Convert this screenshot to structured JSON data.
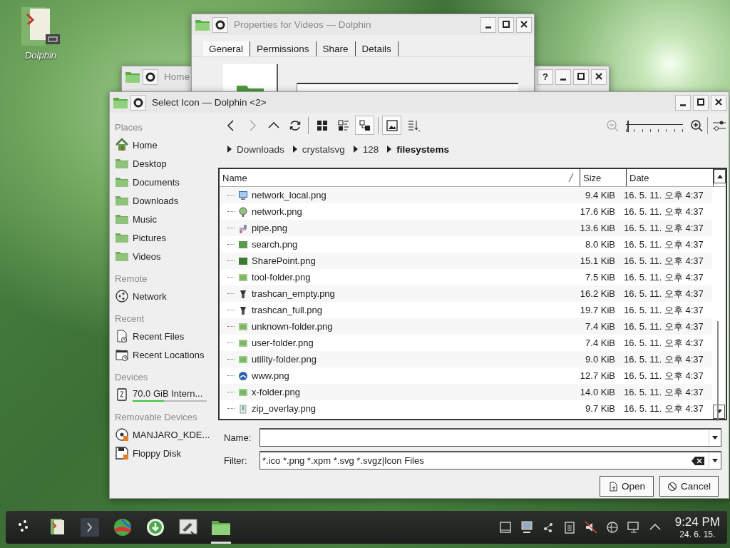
{
  "desktop": {
    "icons": [
      {
        "label": "Dolphin"
      }
    ]
  },
  "home_window": {
    "title": "Home",
    "help_button": "?"
  },
  "properties_window": {
    "title": "Properties for Videos — Dolphin",
    "tabs": [
      {
        "label": "General",
        "selected": true
      },
      {
        "label": "Permissions",
        "selected": false
      },
      {
        "label": "Share",
        "selected": false
      },
      {
        "label": "Details",
        "selected": false
      }
    ]
  },
  "dialog": {
    "title": "Select Icon — Dolphin <2>",
    "places": [
      {
        "heading": "Places",
        "items": [
          {
            "label": "Home",
            "kind": "home"
          },
          {
            "label": "Desktop",
            "kind": "folder"
          },
          {
            "label": "Documents",
            "kind": "folder"
          },
          {
            "label": "Downloads",
            "kind": "folder"
          },
          {
            "label": "Music",
            "kind": "folder"
          },
          {
            "label": "Pictures",
            "kind": "folder"
          },
          {
            "label": "Videos",
            "kind": "folder"
          }
        ]
      },
      {
        "heading": "Remote",
        "items": [
          {
            "label": "Network",
            "kind": "network"
          }
        ]
      },
      {
        "heading": "Recent",
        "items": [
          {
            "label": "Recent Files",
            "kind": "recent-file"
          },
          {
            "label": "Recent Locations",
            "kind": "recent-folder"
          }
        ]
      },
      {
        "heading": "Devices",
        "items": [
          {
            "label": "70.0 GiB Intern...",
            "kind": "drive",
            "level": 0.42
          }
        ]
      },
      {
        "heading": "Removable Devices",
        "items": [
          {
            "label": "MANJARO_KDE...",
            "kind": "disc"
          },
          {
            "label": "Floppy Disk",
            "kind": "floppy"
          }
        ]
      }
    ],
    "toolbar": [
      {
        "kind": "back",
        "disabled": false
      },
      {
        "kind": "forward",
        "disabled": true
      },
      {
        "kind": "up",
        "disabled": false
      },
      {
        "kind": "reload",
        "disabled": false
      },
      {
        "kind": "icons",
        "selected": false
      },
      {
        "kind": "compact",
        "selected": false
      },
      {
        "kind": "details",
        "selected": true
      },
      {
        "kind": "preview",
        "checked": true
      },
      {
        "kind": "sort"
      }
    ],
    "zoom": {
      "level": 0.03
    },
    "breadcrumb": [
      {
        "label": "Downloads",
        "current": false
      },
      {
        "label": "crystalsvg",
        "current": false
      },
      {
        "label": "128",
        "current": false
      },
      {
        "label": "filesystems",
        "current": true
      }
    ],
    "columns": [
      {
        "label": "Name"
      },
      {
        "label": "Size"
      },
      {
        "label": "Date"
      }
    ],
    "rows": [
      {
        "name": "network_local.png",
        "size": "9.4 KiB",
        "date": "16. 5. 11. 오후 4:37",
        "kind": "monitor"
      },
      {
        "name": "network.png",
        "size": "17.6 KiB",
        "date": "16. 5. 11. 오후 4:37",
        "kind": "globe"
      },
      {
        "name": "pipe.png",
        "size": "13.6 KiB",
        "date": "16. 5. 11. 오후 4:37",
        "kind": "pipe"
      },
      {
        "name": "search.png",
        "size": "8.0 KiB",
        "date": "16. 5. 11. 오후 4:37",
        "kind": "folder"
      },
      {
        "name": "SharePoint.png",
        "size": "15.1 KiB",
        "date": "16. 5. 11. 오후 4:37",
        "kind": "folder-dark"
      },
      {
        "name": "tool-folder.png",
        "size": "7.5 KiB",
        "date": "16. 5. 11. 오후 4:37",
        "kind": "folder-light"
      },
      {
        "name": "trashcan_empty.png",
        "size": "16.2 KiB",
        "date": "16. 5. 11. 오후 4:37",
        "kind": "trash"
      },
      {
        "name": "trashcan_full.png",
        "size": "19.7 KiB",
        "date": "16. 5. 11. 오후 4:37",
        "kind": "trash"
      },
      {
        "name": "unknown-folder.png",
        "size": "7.4 KiB",
        "date": "16. 5. 11. 오후 4:37",
        "kind": "folder-light"
      },
      {
        "name": "user-folder.png",
        "size": "7.4 KiB",
        "date": "16. 5. 11. 오후 4:37",
        "kind": "folder-light"
      },
      {
        "name": "utility-folder.png",
        "size": "9.0 KiB",
        "date": "16. 5. 11. 오후 4:37",
        "kind": "folder-light"
      },
      {
        "name": "www.png",
        "size": "12.7 KiB",
        "date": "16. 5. 11. 오후 4:37",
        "kind": "www"
      },
      {
        "name": "x-folder.png",
        "size": "14.0 KiB",
        "date": "16. 5. 11. 오후 4:37",
        "kind": "folder-light"
      },
      {
        "name": "zip_overlay.png",
        "size": "9.7 KiB",
        "date": "16. 5. 11. 오후 4:37",
        "kind": "zip"
      }
    ],
    "name_label": "Name:",
    "filter_label": "Filter:",
    "filter_value": "*.ico *.png *.xpm *.svg *.svgz|Icon Files",
    "buttons": [
      {
        "label": "Open",
        "kind": "open"
      },
      {
        "label": "Cancel",
        "kind": "cancel"
      }
    ]
  },
  "taskbar": {
    "launchers": [
      {
        "kind": "menu",
        "active": false
      },
      {
        "kind": "dolphin",
        "active": false
      },
      {
        "kind": "terminal",
        "active": false
      },
      {
        "kind": "browser",
        "active": false
      },
      {
        "kind": "download",
        "active": false
      },
      {
        "kind": "settings",
        "active": false
      },
      {
        "kind": "folder",
        "active": true
      }
    ],
    "tray": [
      {
        "kind": "window"
      },
      {
        "kind": "monitor"
      },
      {
        "kind": "connect"
      },
      {
        "kind": "clipboard"
      },
      {
        "kind": "muted"
      },
      {
        "kind": "globe"
      },
      {
        "kind": "display"
      },
      {
        "kind": "expand"
      }
    ],
    "time": "9:24 PM",
    "date": "24. 6. 15."
  }
}
